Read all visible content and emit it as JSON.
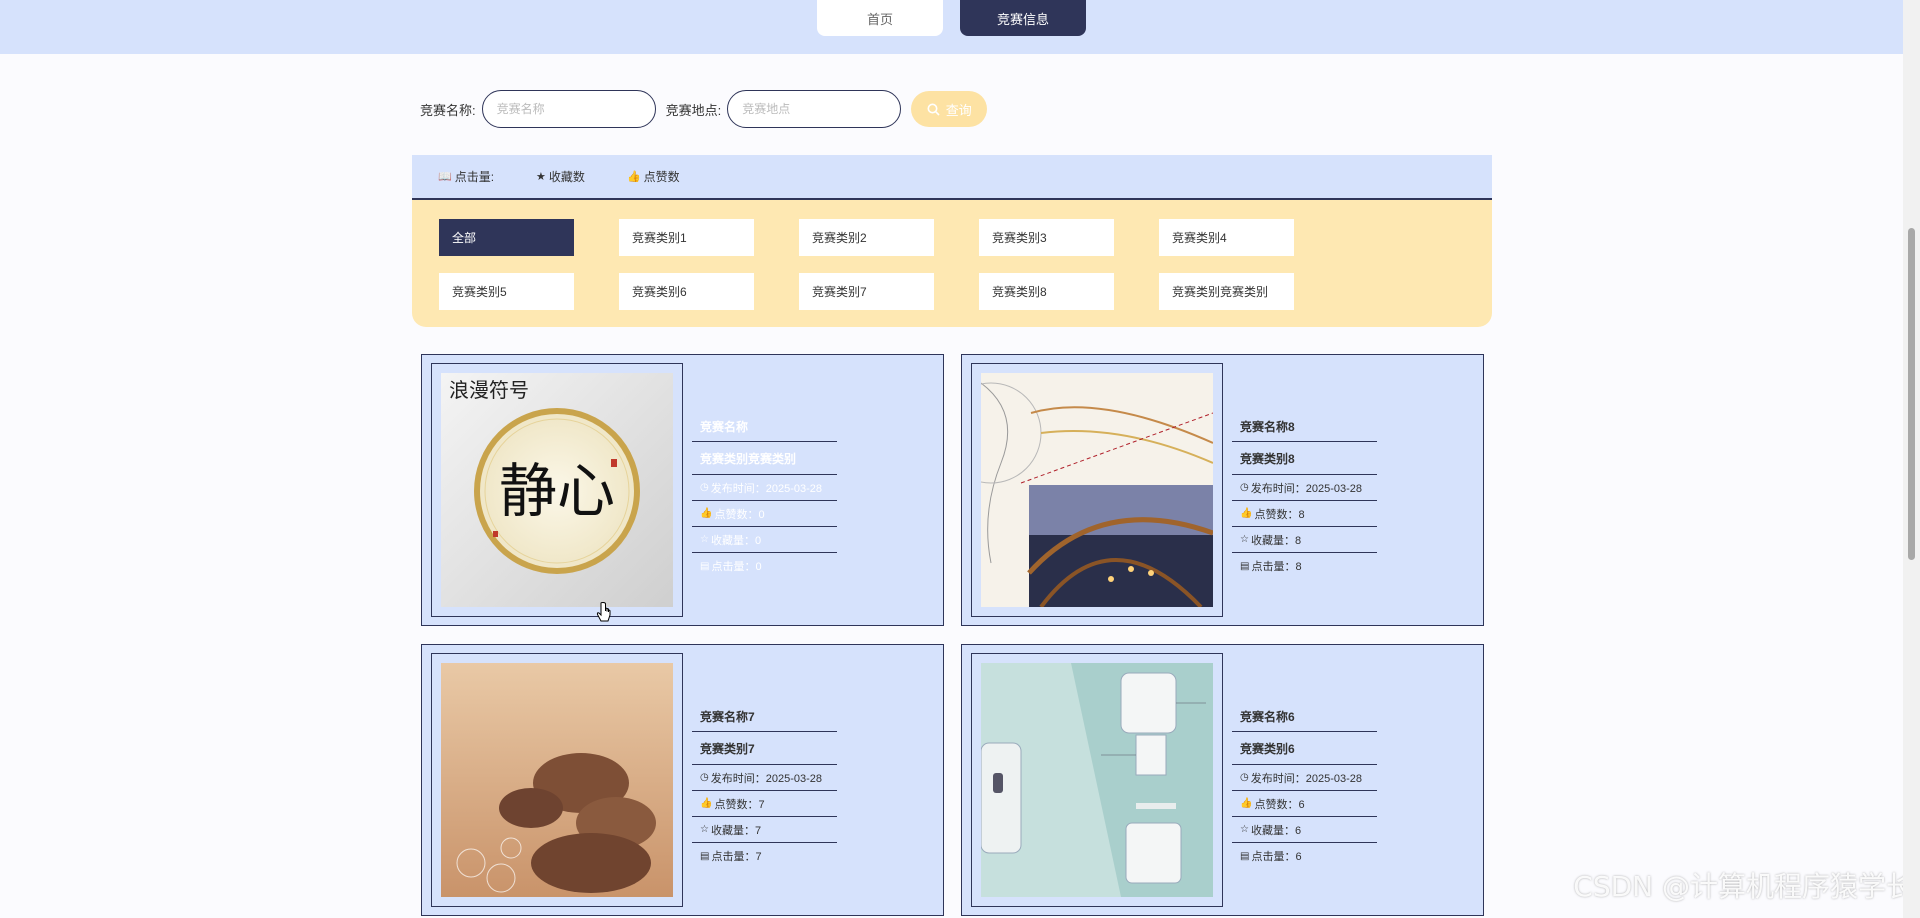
{
  "nav": {
    "home_label": "首页",
    "contest_label": "竞赛信息"
  },
  "search": {
    "name_label": "竞赛名称:",
    "name_placeholder": "竞赛名称",
    "place_label": "竞赛地点:",
    "place_placeholder": "竞赛地点",
    "button_label": "查询",
    "button_icon": "search-icon"
  },
  "sort": {
    "clicks_label": "点击量:",
    "favorites_label": "收藏数",
    "likes_label": "点赞数"
  },
  "categories": [
    "全部",
    "竞赛类别1",
    "竞赛类别2",
    "竞赛类别3",
    "竞赛类别4",
    "竞赛类别5",
    "竞赛类别6",
    "竞赛类别7",
    "竞赛类别8",
    "竞赛类别竞赛类别"
  ],
  "cards": [
    {
      "name": "竞赛名称",
      "category": "竞赛类别竞赛类别",
      "publish": "发布时间：2025-03-28",
      "likes": "点赞数：0",
      "favorites": "收藏量：0",
      "clicks": "点击量：0",
      "image_text": "浪漫符号",
      "image_glyph": "静心"
    },
    {
      "name": "竞赛名称8",
      "category": "竞赛类别8",
      "publish": "发布时间：2025-03-28",
      "likes": "点赞数：8",
      "favorites": "收藏量：8",
      "clicks": "点击量：8"
    },
    {
      "name": "竞赛名称7",
      "category": "竞赛类别7",
      "publish": "发布时间：2025-03-28",
      "likes": "点赞数：7",
      "favorites": "收藏量：7",
      "clicks": "点击量：7"
    },
    {
      "name": "竞赛名称6",
      "category": "竞赛类别6",
      "publish": "发布时间：2025-03-28",
      "likes": "点赞数：6",
      "favorites": "收藏量：6",
      "clicks": "点击量：6"
    }
  ],
  "watermark": "CSDN @计算机程序猿学长",
  "colors": {
    "primary": "#2f3559",
    "light_blue": "#d6e2fc",
    "yellow": "#fee8b2",
    "button_yellow": "#fde2a3"
  }
}
